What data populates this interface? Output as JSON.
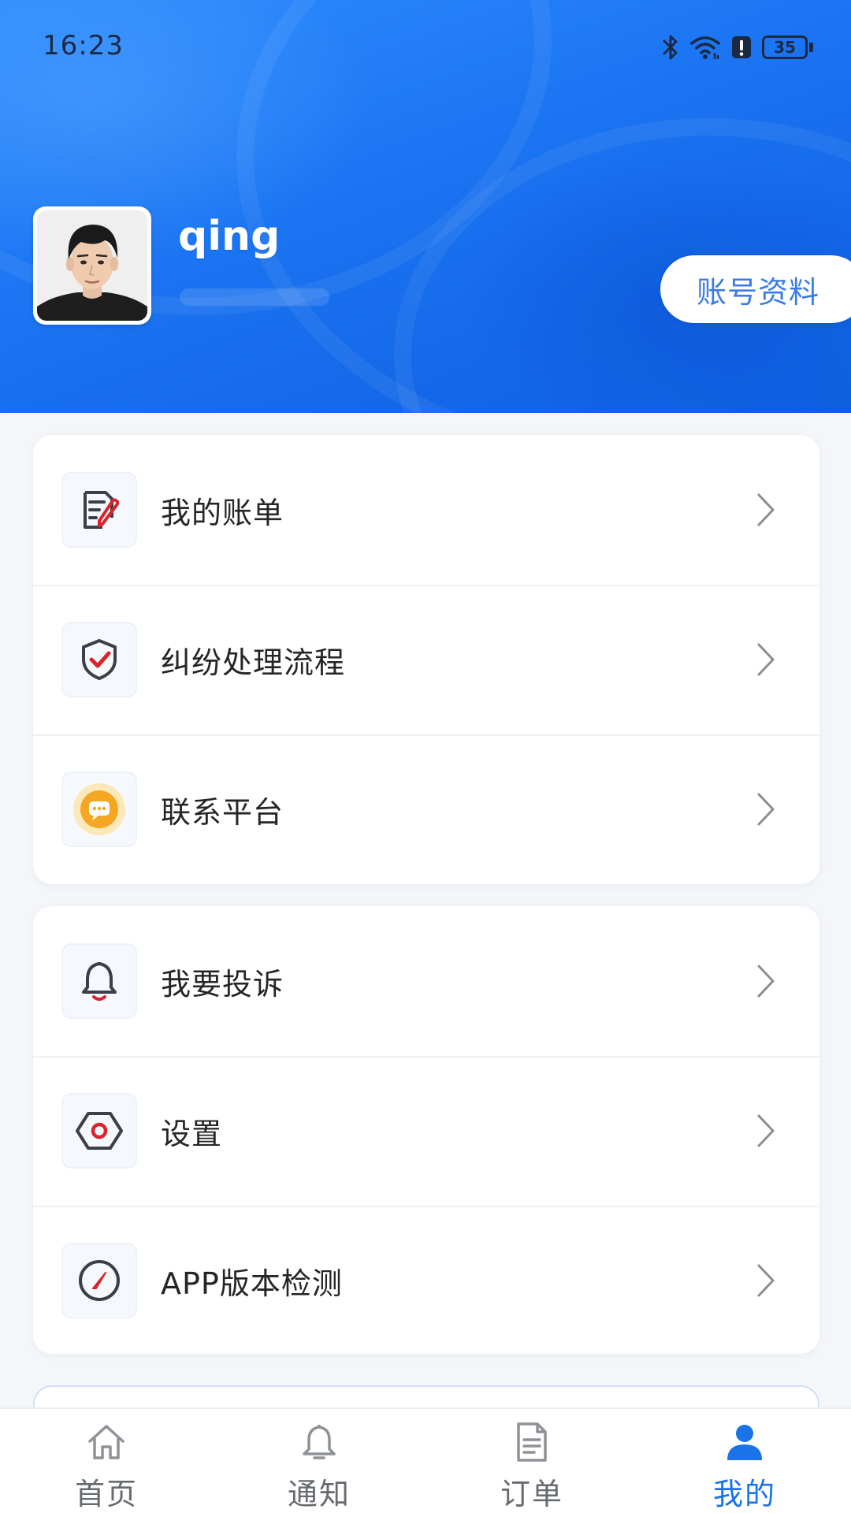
{
  "status_bar": {
    "time": "16:23",
    "battery": "35",
    "icons": [
      "bluetooth-icon",
      "wifi-icon",
      "alert-icon",
      "battery-icon"
    ]
  },
  "profile": {
    "username": "qing",
    "account_button": "账号资料"
  },
  "menu_groups": [
    {
      "items": [
        {
          "label": "我的账单",
          "icon": "bill-edit-icon"
        },
        {
          "label": "纠纷处理流程",
          "icon": "shield-check-icon"
        },
        {
          "label": "联系平台",
          "icon": "chat-bubble-icon"
        }
      ]
    },
    {
      "items": [
        {
          "label": "我要投诉",
          "icon": "bell-icon"
        },
        {
          "label": "设置",
          "icon": "settings-hexagon-icon"
        },
        {
          "label": "APP版本检测",
          "icon": "gauge-icon"
        }
      ]
    }
  ],
  "bottom_nav": {
    "items": [
      {
        "label": "首页",
        "icon": "home-icon",
        "active": false
      },
      {
        "label": "通知",
        "icon": "bell-icon",
        "active": false
      },
      {
        "label": "订单",
        "icon": "document-icon",
        "active": false
      },
      {
        "label": "我的",
        "icon": "user-icon",
        "active": true
      }
    ]
  },
  "colors": {
    "header_blue": "#1b74f2",
    "accent": "#1a73e8",
    "icon_red": "#d9242c",
    "icon_yellow": "#f5a623"
  }
}
